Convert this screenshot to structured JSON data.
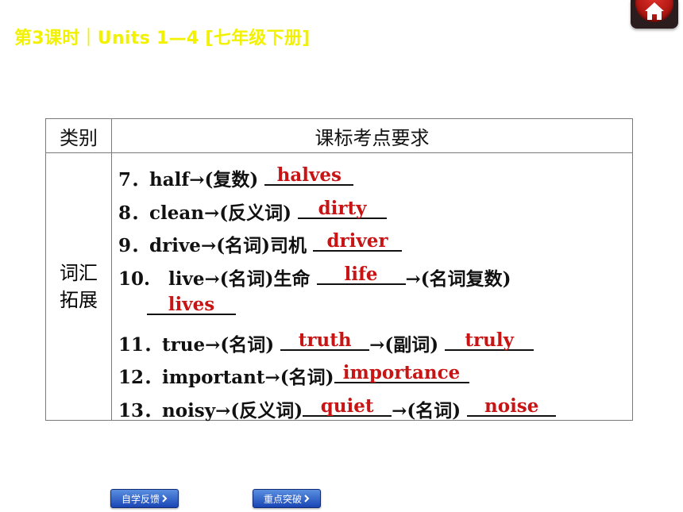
{
  "header": {
    "title": "第3课时｜Units 1—4 [七年级下册]"
  },
  "table": {
    "col_category": "类别",
    "col_requirement": "课标考点要求",
    "category": [
      "词汇",
      "拓展"
    ]
  },
  "items": {
    "i7": {
      "prefix": "7．half→(复数) ",
      "answer": "halves"
    },
    "i8": {
      "prefix": "8．clean→(反义词) ",
      "answer": "dirty"
    },
    "i9": {
      "prefix": "9．drive→(名词)司机 ",
      "answer": "driver"
    },
    "i10": {
      "prefix": "10.　live→(名词)生命 ",
      "answer": "life",
      "middle": "→(名词复数)",
      "answer2": "lives"
    },
    "i11": {
      "prefix": "11．true→(名词) ",
      "answer": "truth",
      "middle": "→(副词) ",
      "answer2": "truly"
    },
    "i12": {
      "prefix": "12．important→(名词)",
      "answer": "importance"
    },
    "i13": {
      "prefix": "13．noisy→(反义词)",
      "answer": "quiet",
      "middle": "→(名词) ",
      "answer2": "noise"
    }
  },
  "nav": {
    "self_study": "自学反馈",
    "key_points": "重点突破"
  },
  "colors": {
    "title": "#f2f200",
    "answer": "#c81414",
    "nav": "#1a46b5"
  },
  "icons": {
    "home": "home-icon",
    "chevron": "chevron-right-icon"
  }
}
